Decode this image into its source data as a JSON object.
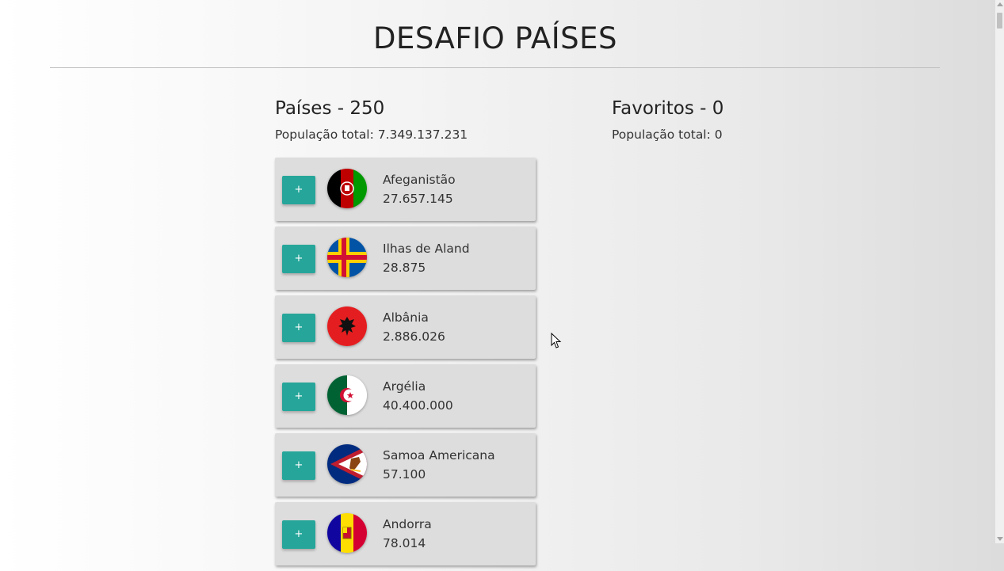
{
  "header": {
    "title": "DESAFIO PAÍSES"
  },
  "countries_panel": {
    "heading": "Países - 250",
    "total_population": "População total: 7.349.137.231"
  },
  "favorites_panel": {
    "heading": "Favoritos - 0",
    "total_population": "População total: 0"
  },
  "add_button_label": "+",
  "countries": [
    {
      "name": "Afeganistão",
      "population": "27.657.145",
      "flag_icon": "afghanistan-flag-icon"
    },
    {
      "name": "Ilhas de Aland",
      "population": "28.875",
      "flag_icon": "aland-flag-icon"
    },
    {
      "name": "Albânia",
      "population": "2.886.026",
      "flag_icon": "albania-flag-icon"
    },
    {
      "name": "Argélia",
      "population": "40.400.000",
      "flag_icon": "algeria-flag-icon"
    },
    {
      "name": "Samoa Americana",
      "population": "57.100",
      "flag_icon": "american-samoa-flag-icon"
    },
    {
      "name": "Andorra",
      "population": "78.014",
      "flag_icon": "andorra-flag-icon"
    }
  ],
  "colors": {
    "accent_button": "#26a69a",
    "card_background": "#dddddd"
  }
}
